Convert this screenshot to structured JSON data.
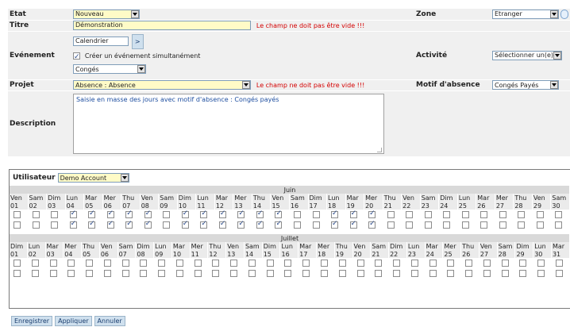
{
  "form": {
    "etat": {
      "label": "Etat",
      "value": "Nouveau"
    },
    "titre": {
      "label": "Titre",
      "value": "Démonstration",
      "error": "Le champ ne doit pas être vide !!!"
    },
    "zone": {
      "label": "Zone",
      "value": "Etranger",
      "icon": "map-icon"
    },
    "evenement": {
      "label": "Evénement",
      "calendar_value": "Calendrier",
      "go_label": ">",
      "checkbox_label": "Créer un événement simultanément",
      "checkbox_checked": true,
      "type_value": "Congés"
    },
    "activite": {
      "label": "Activité",
      "value": "Sélectionner un(e)"
    },
    "projet": {
      "label": "Projet",
      "value": "Absence : Absence",
      "error": "Le champ ne doit pas être vide !!!"
    },
    "motif": {
      "label": "Motif d'absence",
      "value": "Congés Payés"
    },
    "description": {
      "label": "Description",
      "value": "Saisie en masse des jours avec motif d'absence : Congés payés"
    }
  },
  "calendar": {
    "user_label": "Utilisateur",
    "user_value": "Demo Account",
    "months": [
      {
        "name": "Juin",
        "days": [
          {
            "d": "Ven",
            "n": "01",
            "c": [
              false,
              false
            ]
          },
          {
            "d": "Sam",
            "n": "02",
            "c": [
              false,
              false
            ]
          },
          {
            "d": "Dim",
            "n": "03",
            "c": [
              false,
              false
            ]
          },
          {
            "d": "Lun",
            "n": "04",
            "c": [
              true,
              true
            ]
          },
          {
            "d": "Mar",
            "n": "05",
            "c": [
              true,
              true
            ]
          },
          {
            "d": "Mer",
            "n": "06",
            "c": [
              true,
              true
            ]
          },
          {
            "d": "Thu",
            "n": "07",
            "c": [
              true,
              true
            ]
          },
          {
            "d": "Ven",
            "n": "08",
            "c": [
              true,
              true
            ]
          },
          {
            "d": "Sam",
            "n": "09",
            "c": [
              false,
              false
            ]
          },
          {
            "d": "Dim",
            "n": "10",
            "c": [
              true,
              true
            ]
          },
          {
            "d": "Lun",
            "n": "11",
            "c": [
              true,
              true
            ]
          },
          {
            "d": "Mar",
            "n": "12",
            "c": [
              true,
              true
            ]
          },
          {
            "d": "Mer",
            "n": "13",
            "c": [
              true,
              true
            ]
          },
          {
            "d": "Thu",
            "n": "14",
            "c": [
              true,
              true
            ]
          },
          {
            "d": "Ven",
            "n": "15",
            "c": [
              true,
              true
            ]
          },
          {
            "d": "Sam",
            "n": "16",
            "c": [
              false,
              false
            ]
          },
          {
            "d": "Dim",
            "n": "17",
            "c": [
              false,
              false
            ]
          },
          {
            "d": "Lun",
            "n": "18",
            "c": [
              true,
              true
            ]
          },
          {
            "d": "Mar",
            "n": "19",
            "c": [
              true,
              true
            ]
          },
          {
            "d": "Mer",
            "n": "20",
            "c": [
              true,
              true
            ]
          },
          {
            "d": "Thu",
            "n": "21",
            "c": [
              false,
              false
            ]
          },
          {
            "d": "Ven",
            "n": "22",
            "c": [
              false,
              false
            ]
          },
          {
            "d": "Sam",
            "n": "23",
            "c": [
              false,
              false
            ]
          },
          {
            "d": "Dim",
            "n": "24",
            "c": [
              false,
              false
            ]
          },
          {
            "d": "Lun",
            "n": "25",
            "c": [
              false,
              false
            ]
          },
          {
            "d": "Mar",
            "n": "26",
            "c": [
              false,
              false
            ]
          },
          {
            "d": "Mer",
            "n": "27",
            "c": [
              false,
              false
            ]
          },
          {
            "d": "Thu",
            "n": "28",
            "c": [
              false,
              false
            ]
          },
          {
            "d": "Ven",
            "n": "29",
            "c": [
              false,
              false
            ]
          },
          {
            "d": "Sam",
            "n": "30",
            "c": [
              false,
              false
            ]
          }
        ]
      },
      {
        "name": "Juillet",
        "days": [
          {
            "d": "Dim",
            "n": "01"
          },
          {
            "d": "Lun",
            "n": "02"
          },
          {
            "d": "Mar",
            "n": "03"
          },
          {
            "d": "Mer",
            "n": "04"
          },
          {
            "d": "Thu",
            "n": "05"
          },
          {
            "d": "Ven",
            "n": "06"
          },
          {
            "d": "Sam",
            "n": "07"
          },
          {
            "d": "Dim",
            "n": "08"
          },
          {
            "d": "Lun",
            "n": "09"
          },
          {
            "d": "Mar",
            "n": "10"
          },
          {
            "d": "Mer",
            "n": "11"
          },
          {
            "d": "Thu",
            "n": "12"
          },
          {
            "d": "Ven",
            "n": "13"
          },
          {
            "d": "Sam",
            "n": "14"
          },
          {
            "d": "Dim",
            "n": "15"
          },
          {
            "d": "Lun",
            "n": "16"
          },
          {
            "d": "Mar",
            "n": "17"
          },
          {
            "d": "Mer",
            "n": "18"
          },
          {
            "d": "Thu",
            "n": "19"
          },
          {
            "d": "Ven",
            "n": "20"
          },
          {
            "d": "Sam",
            "n": "21"
          },
          {
            "d": "Dim",
            "n": "22"
          },
          {
            "d": "Lun",
            "n": "23"
          },
          {
            "d": "Mar",
            "n": "24"
          },
          {
            "d": "Mer",
            "n": "25"
          },
          {
            "d": "Thu",
            "n": "26"
          },
          {
            "d": "Ven",
            "n": "27"
          },
          {
            "d": "Sam",
            "n": "28"
          },
          {
            "d": "Dim",
            "n": "29"
          },
          {
            "d": "Lun",
            "n": "30"
          },
          {
            "d": "Mar",
            "n": "31"
          }
        ]
      }
    ]
  },
  "actions": {
    "save": "Enregistrer",
    "apply": "Appliquer",
    "cancel": "Annuler"
  }
}
